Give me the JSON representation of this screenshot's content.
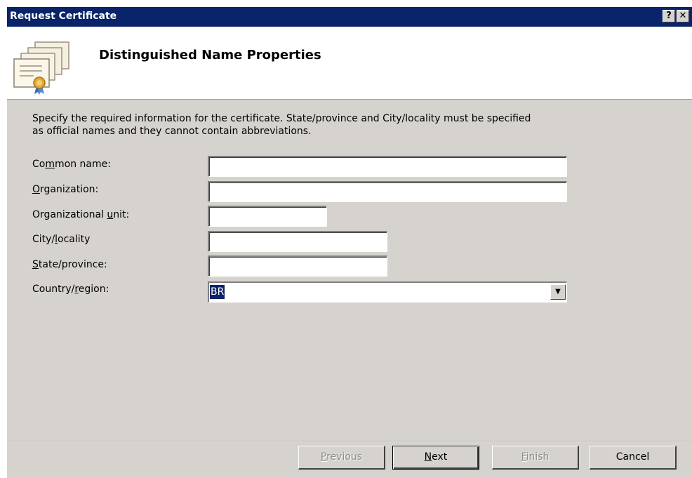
{
  "window": {
    "title": "Request Certificate",
    "help_label": "?",
    "close_label": "✕"
  },
  "header": {
    "title": "Distinguished Name Properties",
    "icon": "certificate-icon"
  },
  "instructions": {
    "line1": "Specify the required information for the certificate. State/province and City/locality must be specified",
    "line2": "as official names and they cannot contain abbreviations."
  },
  "fields": {
    "common_name": {
      "pre": "Co",
      "key": "m",
      "post": "mon name:",
      "value": ""
    },
    "organization": {
      "pre": "",
      "key": "O",
      "post": "rganization:",
      "value": ""
    },
    "org_unit": {
      "pre": "Organizational ",
      "key": "u",
      "post": "nit:",
      "value": ""
    },
    "city": {
      "pre": "City/",
      "key": "l",
      "post": "ocality",
      "value": ""
    },
    "state": {
      "pre": "",
      "key": "S",
      "post": "tate/province:",
      "value": ""
    },
    "country": {
      "pre": "Country/",
      "key": "r",
      "post": "egion:",
      "value": "BR"
    }
  },
  "buttons": {
    "previous": {
      "key": "P",
      "post": "revious",
      "enabled": false
    },
    "next": {
      "key": "N",
      "post": "ext",
      "enabled": true
    },
    "finish": {
      "key": "F",
      "post": "inish",
      "enabled": false
    },
    "cancel": {
      "label": "Cancel",
      "enabled": true
    }
  },
  "colors": {
    "titlebar": "#0a246a",
    "dialog_bg": "#d6d3ce",
    "selection": "#0a246a"
  }
}
